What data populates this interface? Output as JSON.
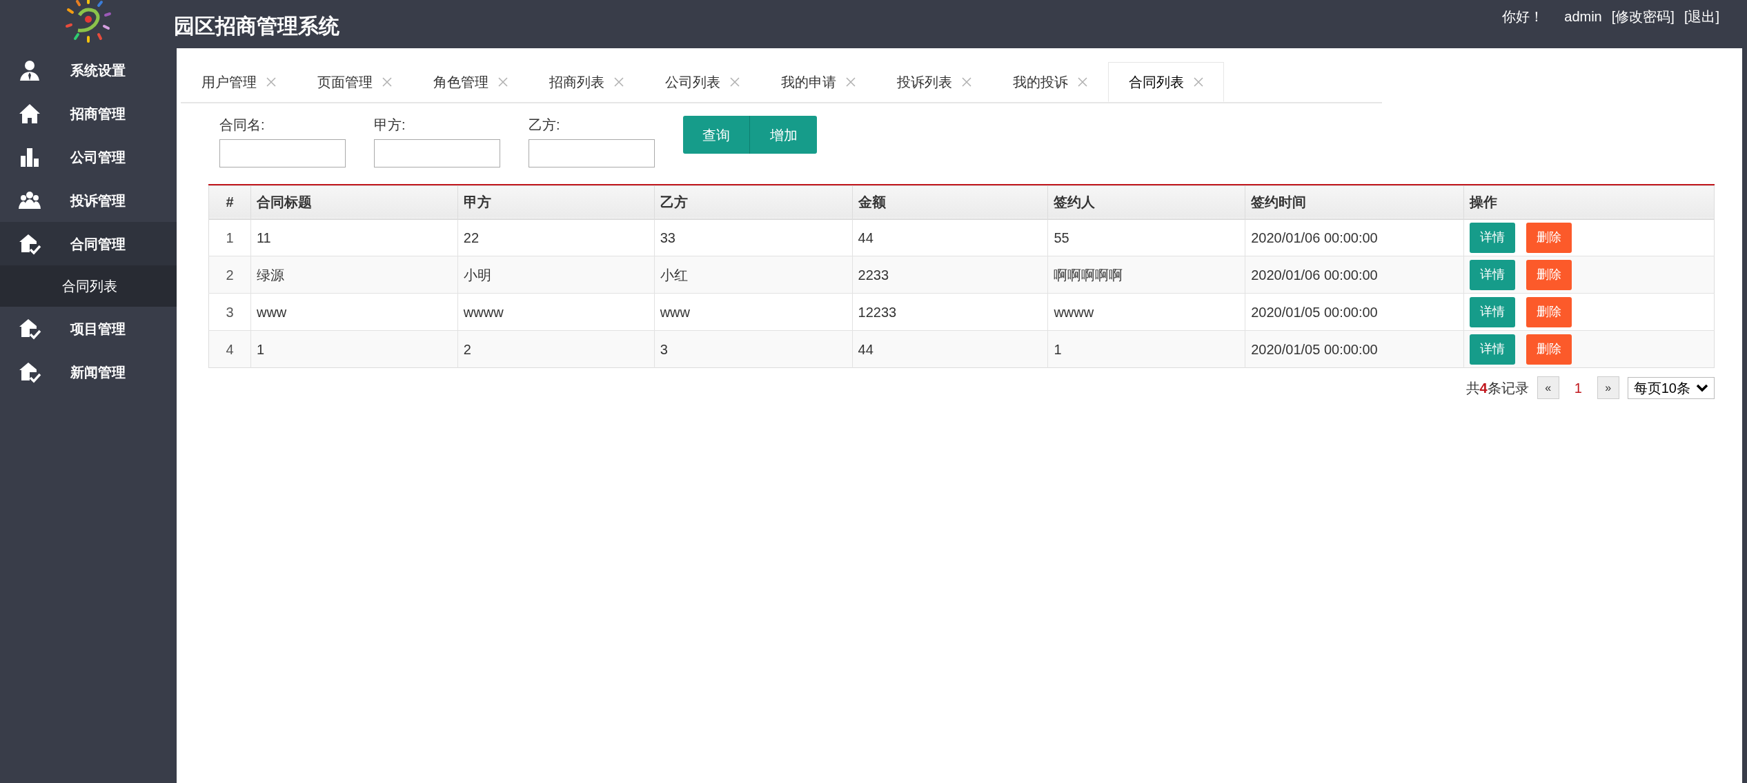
{
  "header": {
    "title": "园区招商管理系统",
    "greeting": "你好！",
    "username": "admin",
    "links": [
      "[修改密码]",
      "[退出]"
    ]
  },
  "sidebar": {
    "items": [
      {
        "label": "系统设置",
        "kind": "person"
      },
      {
        "label": "招商管理",
        "kind": "house"
      },
      {
        "label": "公司管理",
        "kind": "chart"
      },
      {
        "label": "投诉管理",
        "kind": "group"
      },
      {
        "label": "合同管理",
        "kind": "housecheck",
        "expanded": true,
        "children": [
          {
            "label": "合同列表",
            "selected": true
          }
        ]
      },
      {
        "label": "项目管理",
        "kind": "housecheck"
      },
      {
        "label": "新闻管理",
        "kind": "housecheck"
      }
    ]
  },
  "tabs": [
    {
      "label": "用户管理",
      "selected": false
    },
    {
      "label": "页面管理",
      "selected": false
    },
    {
      "label": "角色管理",
      "selected": false
    },
    {
      "label": "招商列表",
      "selected": false
    },
    {
      "label": "公司列表",
      "selected": false
    },
    {
      "label": "我的申请",
      "selected": false
    },
    {
      "label": "投诉列表",
      "selected": false
    },
    {
      "label": "我的投诉",
      "selected": false
    },
    {
      "label": "合同列表",
      "selected": true
    }
  ],
  "search": {
    "fields": [
      {
        "label": "合同名:"
      },
      {
        "label": "甲方:"
      },
      {
        "label": "乙方:"
      }
    ],
    "buttons": [
      "查询",
      "增加"
    ]
  },
  "table": {
    "columns": [
      "#",
      "合同标题",
      "甲方",
      "乙方",
      "金额",
      "签约人",
      "签约时间",
      "操作"
    ],
    "rows": [
      {
        "cells": [
          "1",
          "11",
          "22",
          "33",
          "44",
          "55",
          "2020/01/06 00:00:00"
        ],
        "actions": [
          "详情",
          "删除"
        ]
      },
      {
        "cells": [
          "2",
          "绿源",
          "小明",
          "小红",
          "2233",
          "啊啊啊啊啊",
          "2020/01/06 00:00:00"
        ],
        "actions": [
          "详情",
          "删除"
        ]
      },
      {
        "cells": [
          "3",
          "www",
          "wwww",
          "www",
          "12233",
          "wwww",
          "2020/01/05 00:00:00"
        ],
        "actions": [
          "详情",
          "删除"
        ]
      },
      {
        "cells": [
          "4",
          "1",
          "2",
          "3",
          "44",
          "1",
          "2020/01/05 00:00:00"
        ],
        "actions": [
          "详情",
          "删除"
        ]
      }
    ]
  },
  "pagination": {
    "summary": "共**4**条记录",
    "prev": "«",
    "pages": [
      {
        "label": "1",
        "selected": true
      }
    ],
    "next": "»",
    "page_size": "每页10条"
  }
}
